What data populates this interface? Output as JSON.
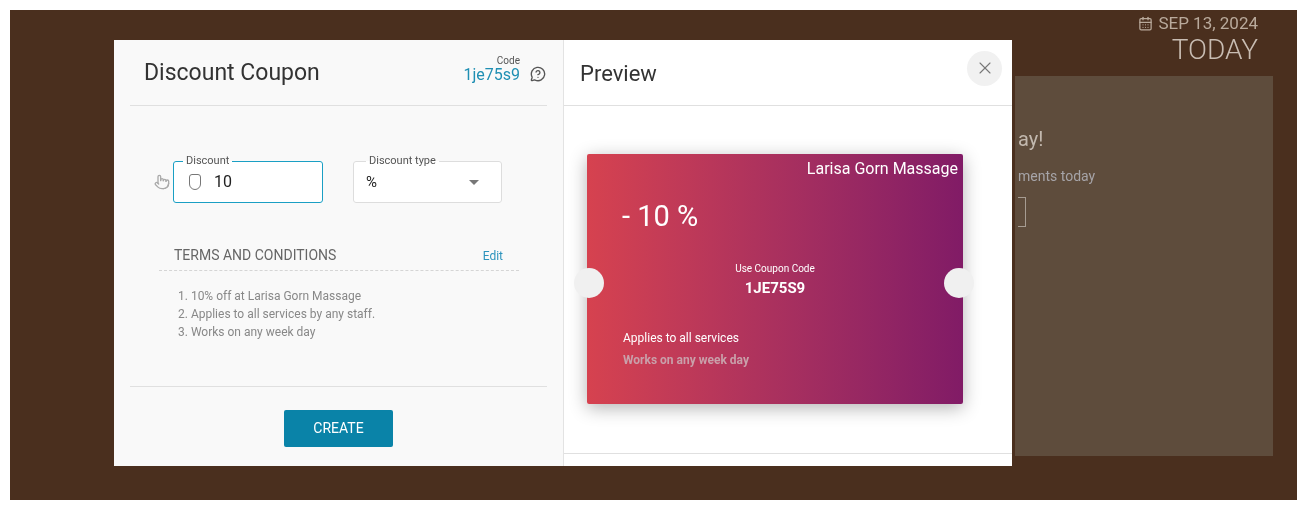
{
  "background": {
    "date": "SEP 13, 2024",
    "today": "TODAY",
    "panel_heading": "ay!",
    "panel_text": "ments today"
  },
  "form": {
    "title": "Discount Coupon",
    "code_label": "Code",
    "code": "1je75s9",
    "discount": {
      "label": "Discount",
      "value": "10"
    },
    "discount_type": {
      "label": "Discount type",
      "value": "%"
    },
    "terms": {
      "heading": "TERMS AND CONDITIONS",
      "edit": "Edit",
      "items": [
        "1. 10% off at Larisa Gorn Massage",
        "2. Applies to all services by any staff.",
        "3. Works on any week day"
      ]
    },
    "create_button": "CREATE"
  },
  "preview": {
    "title": "Preview",
    "coupon": {
      "business": "Larisa Gorn Massage",
      "amount": "- 10 %",
      "code_label": "Use Coupon Code",
      "code": "1JE75S9",
      "line_1": "Applies to all services",
      "line_2": "Works on any week day"
    }
  }
}
